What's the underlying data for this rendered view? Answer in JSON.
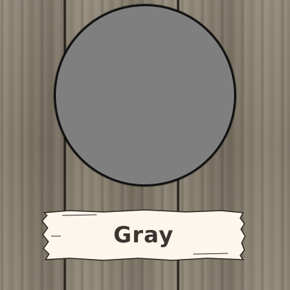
{
  "swatch": {
    "color": "#7f7f7f",
    "label": "Gray"
  },
  "banner": {
    "fill": "#fdf6ec",
    "stroke": "#2a2520"
  },
  "background": {
    "texture": "weathered-wood-planks"
  }
}
